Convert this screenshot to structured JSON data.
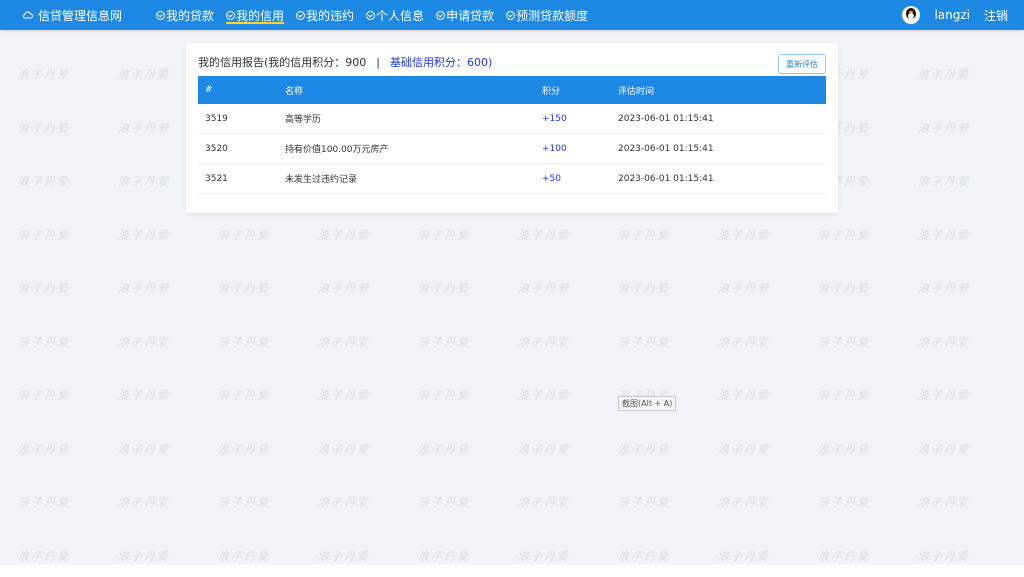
{
  "brand": {
    "title": "信贷管理信息网",
    "icon": "cloud-icon"
  },
  "nav": {
    "items": [
      {
        "label": "我的贷款",
        "active": false
      },
      {
        "label": "我的信用",
        "active": true
      },
      {
        "label": "我的违约",
        "active": false
      },
      {
        "label": "个人信息",
        "active": false
      },
      {
        "label": "申请贷款",
        "active": false
      },
      {
        "label": "预测贷款额度",
        "active": false
      }
    ]
  },
  "user": {
    "name": "langzi",
    "logout_label": "注销",
    "avatar_icon": "qq-penguin-icon"
  },
  "watermark": {
    "text": "浪子丹爱"
  },
  "report": {
    "title": "我的信用报告(我的信用积分：900",
    "separator": "|",
    "base_score": "基础信用积分：600)",
    "reevaluate_label": "重新评估"
  },
  "table": {
    "headers": [
      "#",
      "名称",
      "积分",
      "评估时间"
    ],
    "rows": [
      {
        "id": "3519",
        "name": "高等学历",
        "score": "+150",
        "time": "2023-06-01 01:15:41"
      },
      {
        "id": "3520",
        "name": "持有价值100.00万元房产",
        "score": "+100",
        "time": "2023-06-01 01:15:41"
      },
      {
        "id": "3521",
        "name": "未发生过违约记录",
        "score": "+50",
        "time": "2023-06-01 01:15:41"
      }
    ]
  },
  "tooltip": {
    "text": "截图(Alt + A)"
  },
  "colors": {
    "primary": "#1e88e5",
    "active_underline": "#fdd835",
    "score": "#1e3ad6",
    "background": "#f0f3f8"
  }
}
